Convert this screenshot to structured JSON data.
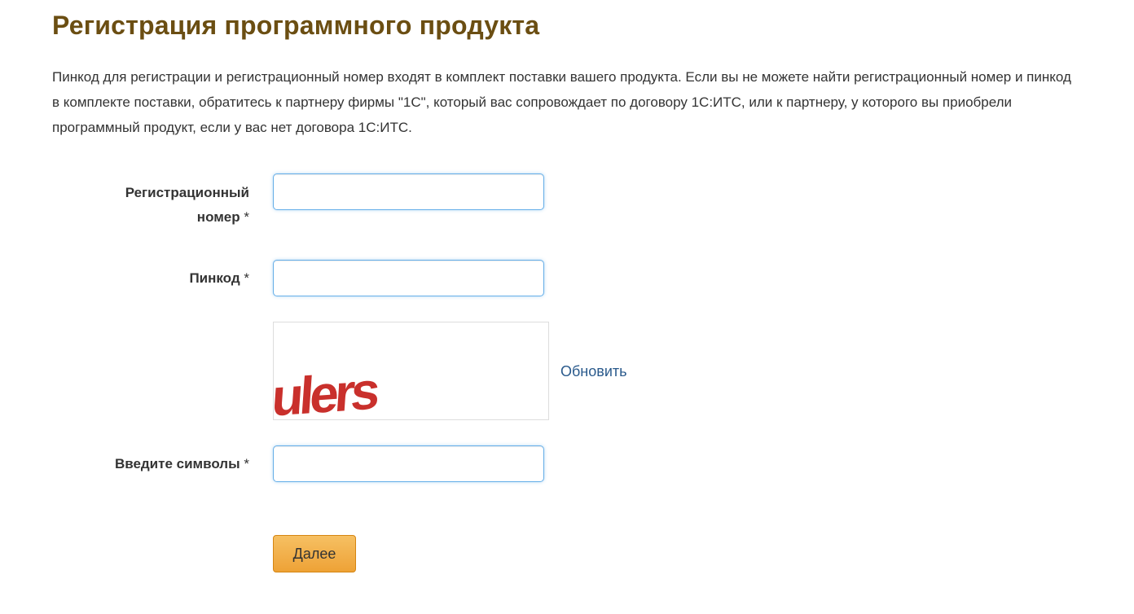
{
  "page": {
    "title": "Регистрация программного продукта",
    "intro": "Пинкод для регистрации и регистрационный номер входят в комплект поставки вашего продукта. Если вы не можете найти регистрационный номер и пинкод в комплекте поставки, обратитесь к партнеру фирмы \"1С\", который вас сопровождает по договору 1С:ИТС, или к партнеру, у которого вы приобрели программный продукт, если у вас нет договора 1С:ИТС."
  },
  "form": {
    "reg_number": {
      "label_line1": "Регистрационный",
      "label_line2": "номер",
      "required_mark": "*",
      "value": ""
    },
    "pincode": {
      "label": "Пинкод",
      "required_mark": "*",
      "value": ""
    },
    "captcha": {
      "text": "ulers",
      "color": "#c9302c",
      "refresh_label": "Обновить"
    },
    "symbols": {
      "label": "Введите символы",
      "required_mark": "*",
      "value": ""
    },
    "submit_label": "Далее"
  },
  "colors": {
    "title": "#6b4e12",
    "link": "#2a5a8c",
    "input_focus_border": "#66afe9",
    "button": "#f0ad4e"
  }
}
